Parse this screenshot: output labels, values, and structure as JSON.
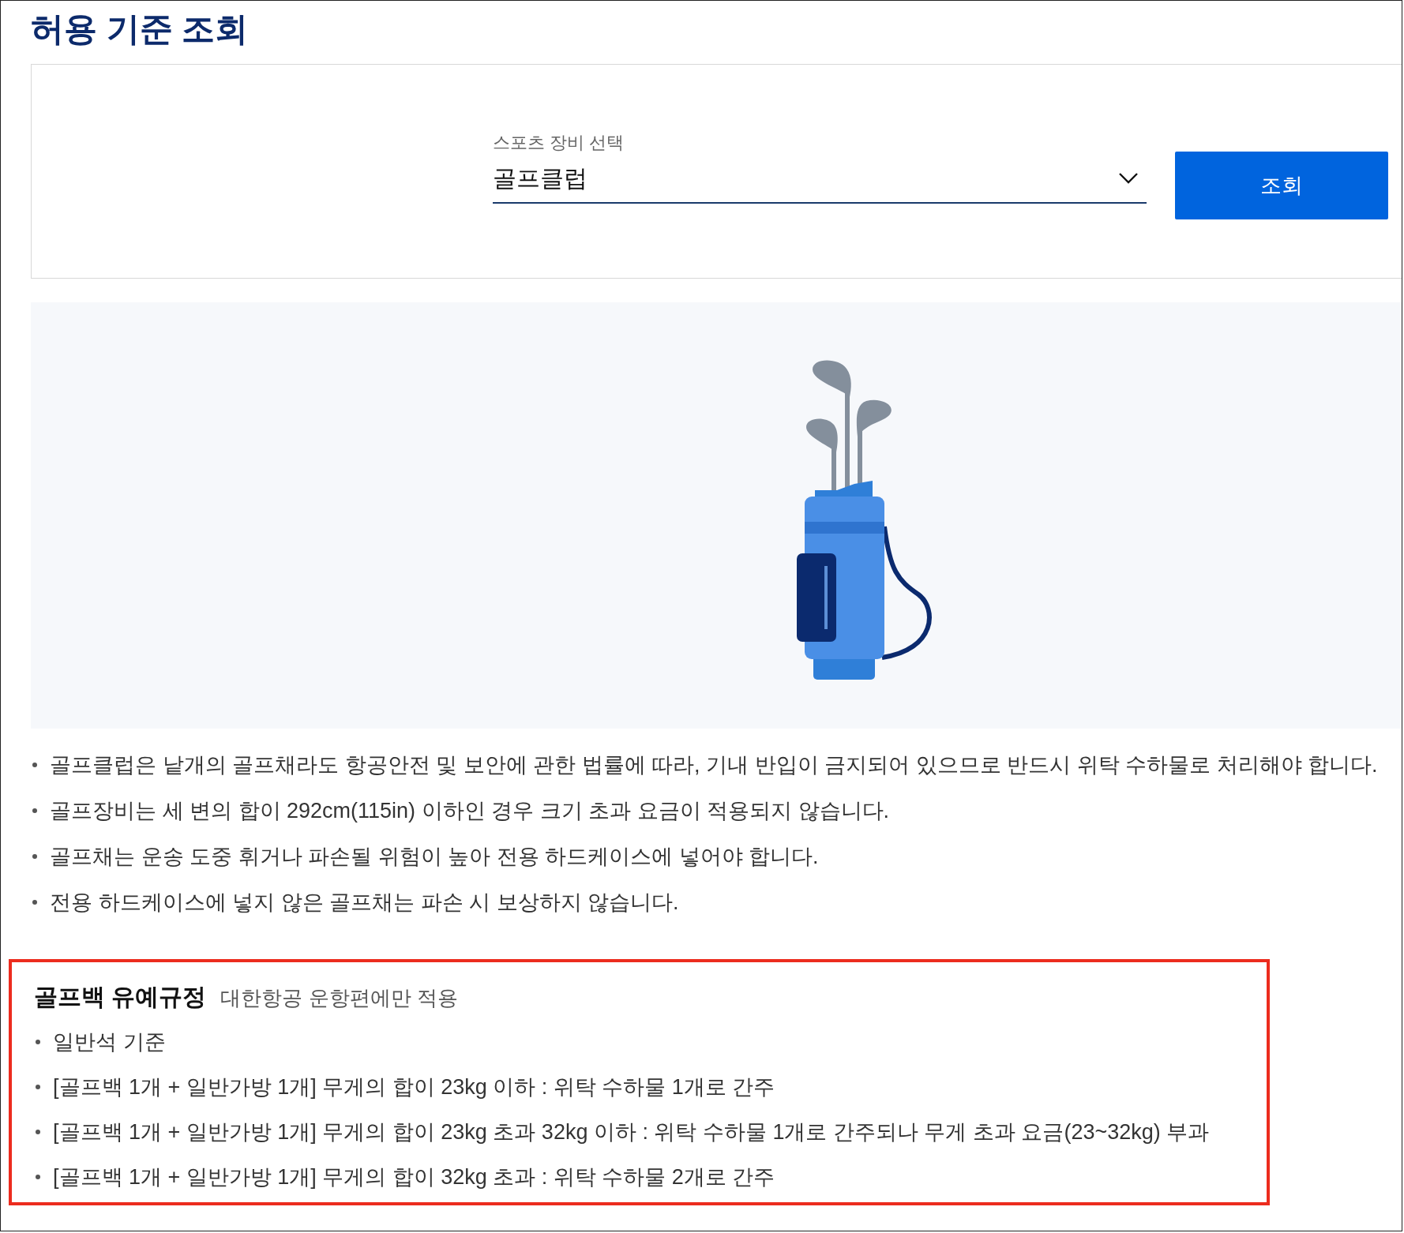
{
  "page_title": "허용 기준 조회",
  "search": {
    "label": "스포츠 장비 선택",
    "value": "골프클럽",
    "button": "조회"
  },
  "notes": [
    "골프클럽은 낱개의 골프채라도 항공안전 및 보안에 관한 법률에 따라, 기내 반입이 금지되어 있으므로 반드시 위탁 수하물로 처리해야 합니다.",
    "골프장비는 세 변의 합이 292cm(115in) 이하인 경우 크기 초과 요금이 적용되지 않습니다.",
    "골프채는 운송 도중 휘거나 파손될 위험이 높아 전용 하드케이스에 넣어야 합니다.",
    "전용 하드케이스에 넣지 않은 골프채는 파손 시 보상하지 않습니다."
  ],
  "grace_rule": {
    "title": "골프백 유예규정",
    "subtitle": "대한항공 운항편에만 적용",
    "highlighted": true,
    "items": [
      "일반석 기준",
      "[골프백 1개 + 일반가방 1개] 무게의 합이 23kg 이하 : 위탁 수하물 1개로 간주",
      "[골프백 1개 + 일반가방 1개] 무게의 합이 23kg 초과 32kg 이하 : 위탁 수하물 1개로 간주되나 무게 초과 요금(23~32kg) 부과",
      "[골프백 1개 + 일반가방 1개] 무게의 합이 32kg 초과 : 위탁 수하물 2개로 간주"
    ]
  }
}
